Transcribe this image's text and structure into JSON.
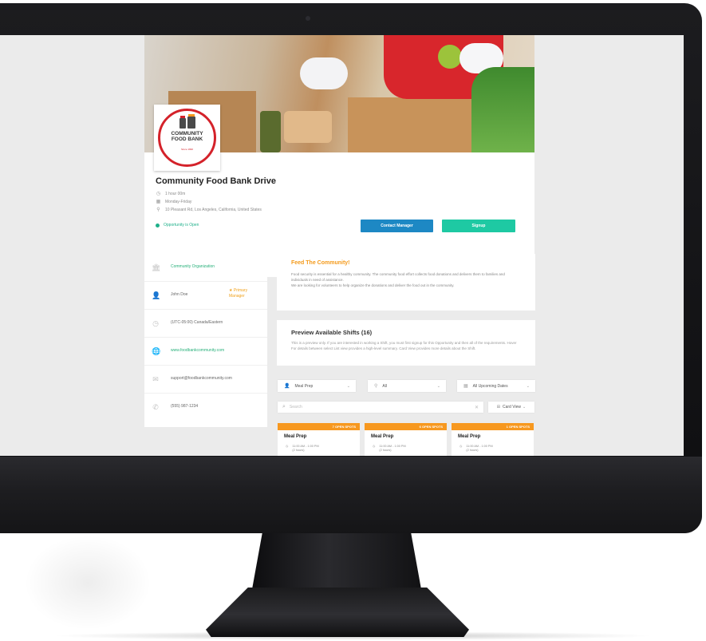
{
  "event": {
    "title": "Community Food Bank Drive",
    "meta": [
      "1 hour 00m",
      "Monday-Friday",
      "10 Pleasant Rd, Los Angeles, California, United States"
    ],
    "status": "Opportunity is Open",
    "contact_label": "Contact Manager",
    "signup_label": "Signup"
  },
  "logo": {
    "name_line1": "COMMUNITY",
    "name_line2": "FOOD BANK",
    "since": "Since 1990"
  },
  "sidebar": {
    "organization": "Community Organization",
    "manager_name": "John Doe",
    "manager_badge_line1": "★ Primary",
    "manager_badge_line2": "Manager",
    "timezone": "(UTC-05:00) Canada/Eastern",
    "website": "www.foodbankcommunity.com",
    "email": "support@foodbankcommunity.com",
    "phone": "(555) 987-1234"
  },
  "about": {
    "title": "Feed The Community!",
    "body_1": "Food security is essential for a healthy community. The community food effort collects food donations and delivers them to families and individuals in need of assistance.",
    "body_2": "We are looking for volunteers to help organize the donations and deliver the food out in the community."
  },
  "shifts": {
    "title": "Preview Available Shifts (16)",
    "body": "This is a preview only. If you are interested in working a Shift, you must first signup for this Opportunity and then all of the requirements. Hover For details between select List view provides a high-level summary. Card View provides more details about the Shift."
  },
  "filters": {
    "role": "Meal Prep",
    "location": "All",
    "dates": "All Upcoming Dates",
    "search_placeholder": "Search",
    "view": "Card View"
  },
  "shift_cards": [
    {
      "spots": "7 OPEN SPOTS",
      "title": "Meal Prep",
      "time": "11:00 AM - 1:00 PM",
      "duration": "(2 hours)"
    },
    {
      "spots": "6 OPEN SPOTS",
      "title": "Meal Prep",
      "time": "11:00 AM - 1:00 PM",
      "duration": "(2 hours)"
    },
    {
      "spots": "1 OPEN SPOTS",
      "title": "Meal Prep",
      "time": "11:00 AM - 1:00 PM",
      "duration": "(2 hours)"
    }
  ],
  "colors": {
    "accent_orange": "#f7981f",
    "contact_blue": "#1d88c4",
    "signup_teal": "#1ec9a3",
    "status_green": "#1fb08a",
    "logo_red": "#d4222a"
  }
}
